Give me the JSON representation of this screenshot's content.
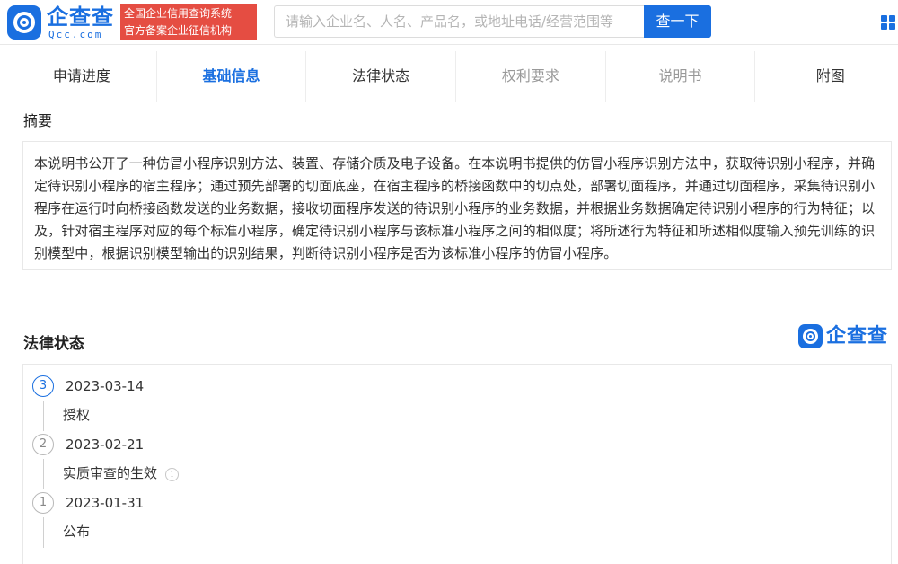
{
  "header": {
    "logo_name": "企查查",
    "logo_sub": "Qcc.com",
    "slogan_line1": "全国企业信用查询系统",
    "slogan_line2": "官方备案企业征信机构",
    "search_placeholder": "请输入企业名、人名、产品名，或地址电话/经营范围等",
    "search_button": "查一下"
  },
  "tabs": [
    {
      "label": "申请进度"
    },
    {
      "label": "基础信息"
    },
    {
      "label": "法律状态"
    },
    {
      "label": "权利要求"
    },
    {
      "label": "说明书"
    },
    {
      "label": "附图"
    }
  ],
  "abstract": {
    "title": "摘要",
    "text": "本说明书公开了一种仿冒小程序识别方法、装置、存储介质及电子设备。在本说明书提供的仿冒小程序识别方法中，获取待识别小程序，并确定待识别小程序的宿主程序；通过预先部署的切面底座，在宿主程序的桥接函数中的切点处，部署切面程序，并通过切面程序，采集待识别小程序在运行时向桥接函数发送的业务数据，接收切面程序发送的待识别小程序的业务数据，并根据业务数据确定待识别小程序的行为特征；以及，针对宿主程序对应的每个标准小程序，确定待识别小程序与该标准小程序之间的相似度；将所述行为特征和所述相似度输入预先训练的识别模型中，根据识别模型输出的识别结果，判断待识别小程序是否为该标准小程序的仿冒小程序。"
  },
  "legal": {
    "title": "法律状态",
    "brand": "企查查",
    "events": [
      {
        "step": "3",
        "date": "2023-03-14",
        "label": "授权"
      },
      {
        "step": "2",
        "date": "2023-02-21",
        "label": "实质审查的生效"
      },
      {
        "step": "1",
        "date": "2023-01-31",
        "label": "公布"
      }
    ],
    "info_glyph": "i"
  },
  "colors": {
    "accent": "#1a6fe0",
    "slogan_bg": "#e54d42"
  }
}
